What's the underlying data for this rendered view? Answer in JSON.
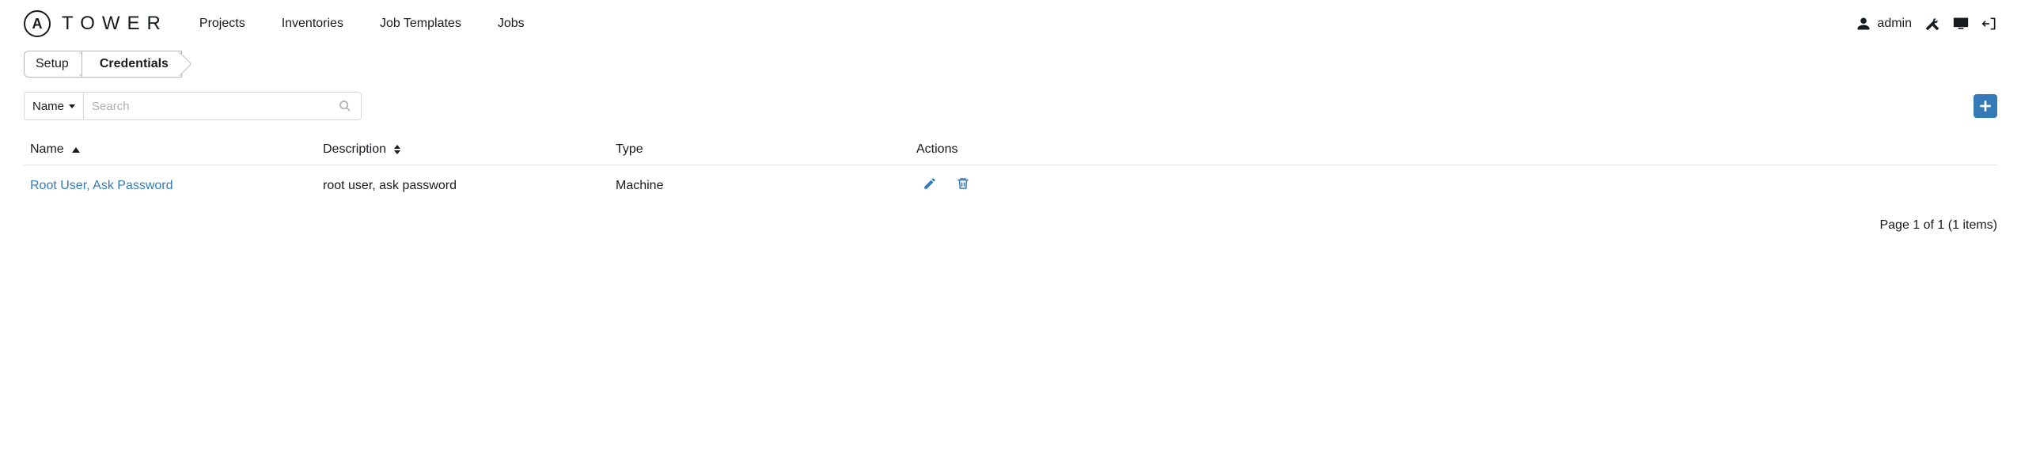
{
  "brand": {
    "logo_letter": "A",
    "name": "TOWER"
  },
  "nav": {
    "items": [
      {
        "label": "Projects"
      },
      {
        "label": "Inventories"
      },
      {
        "label": "Job Templates"
      },
      {
        "label": "Jobs"
      }
    ]
  },
  "user": {
    "name": "admin"
  },
  "breadcrumb": {
    "items": [
      {
        "label": "Setup",
        "active": false
      },
      {
        "label": "Credentials",
        "active": true
      }
    ]
  },
  "search": {
    "field_label": "Name",
    "placeholder": "Search",
    "value": ""
  },
  "table": {
    "headers": {
      "name": "Name",
      "description": "Description",
      "type": "Type",
      "actions": "Actions"
    },
    "rows": [
      {
        "name": "Root User, Ask Password",
        "description": "root user, ask password",
        "type": "Machine"
      }
    ]
  },
  "pagination": {
    "text": "Page 1 of 1 (1 items)"
  }
}
